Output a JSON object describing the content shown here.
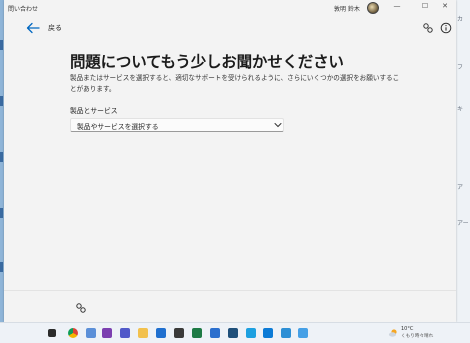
{
  "window": {
    "app_title": "問い合わせ",
    "user_name": "敦明 鈴木",
    "controls": {
      "minimize": "—",
      "maximize": "☐",
      "close": "✕"
    }
  },
  "nav": {
    "back_label": "戻る",
    "icons": [
      "back-arrow-icon",
      "share-icon",
      "info-icon"
    ]
  },
  "content": {
    "title": "問題についてもう少しお聞かせください",
    "description": "製品またはサービスを選択すると、適切なサポートを受けられるように、さらにいくつかの選択をお願いすることがあります。",
    "field_label": "製品とサービス",
    "select_value": "製品やサービスを選択する"
  },
  "footer": {
    "icon": "share-icon"
  },
  "taskbar": {
    "icons": [
      "taskview-icon",
      "chrome-icon",
      "network-icon",
      "onenote-icon",
      "teams-icon",
      "file-explorer-icon",
      "calendar-icon",
      "terminal-icon",
      "excel-icon",
      "word-icon",
      "outlook-icon",
      "chat-icon",
      "store-icon",
      "settings-icon",
      "sync-icon"
    ],
    "weather_temp": "10°C",
    "weather_desc": "くもり時々晴れ"
  },
  "desktop_side": {
    "right_labels": [
      "カ",
      "フ",
      "キ",
      "ア",
      "アー"
    ]
  },
  "colors": {
    "accent": "#0067c0",
    "background": "#f3f3f3",
    "title": "#1b1b1b"
  }
}
